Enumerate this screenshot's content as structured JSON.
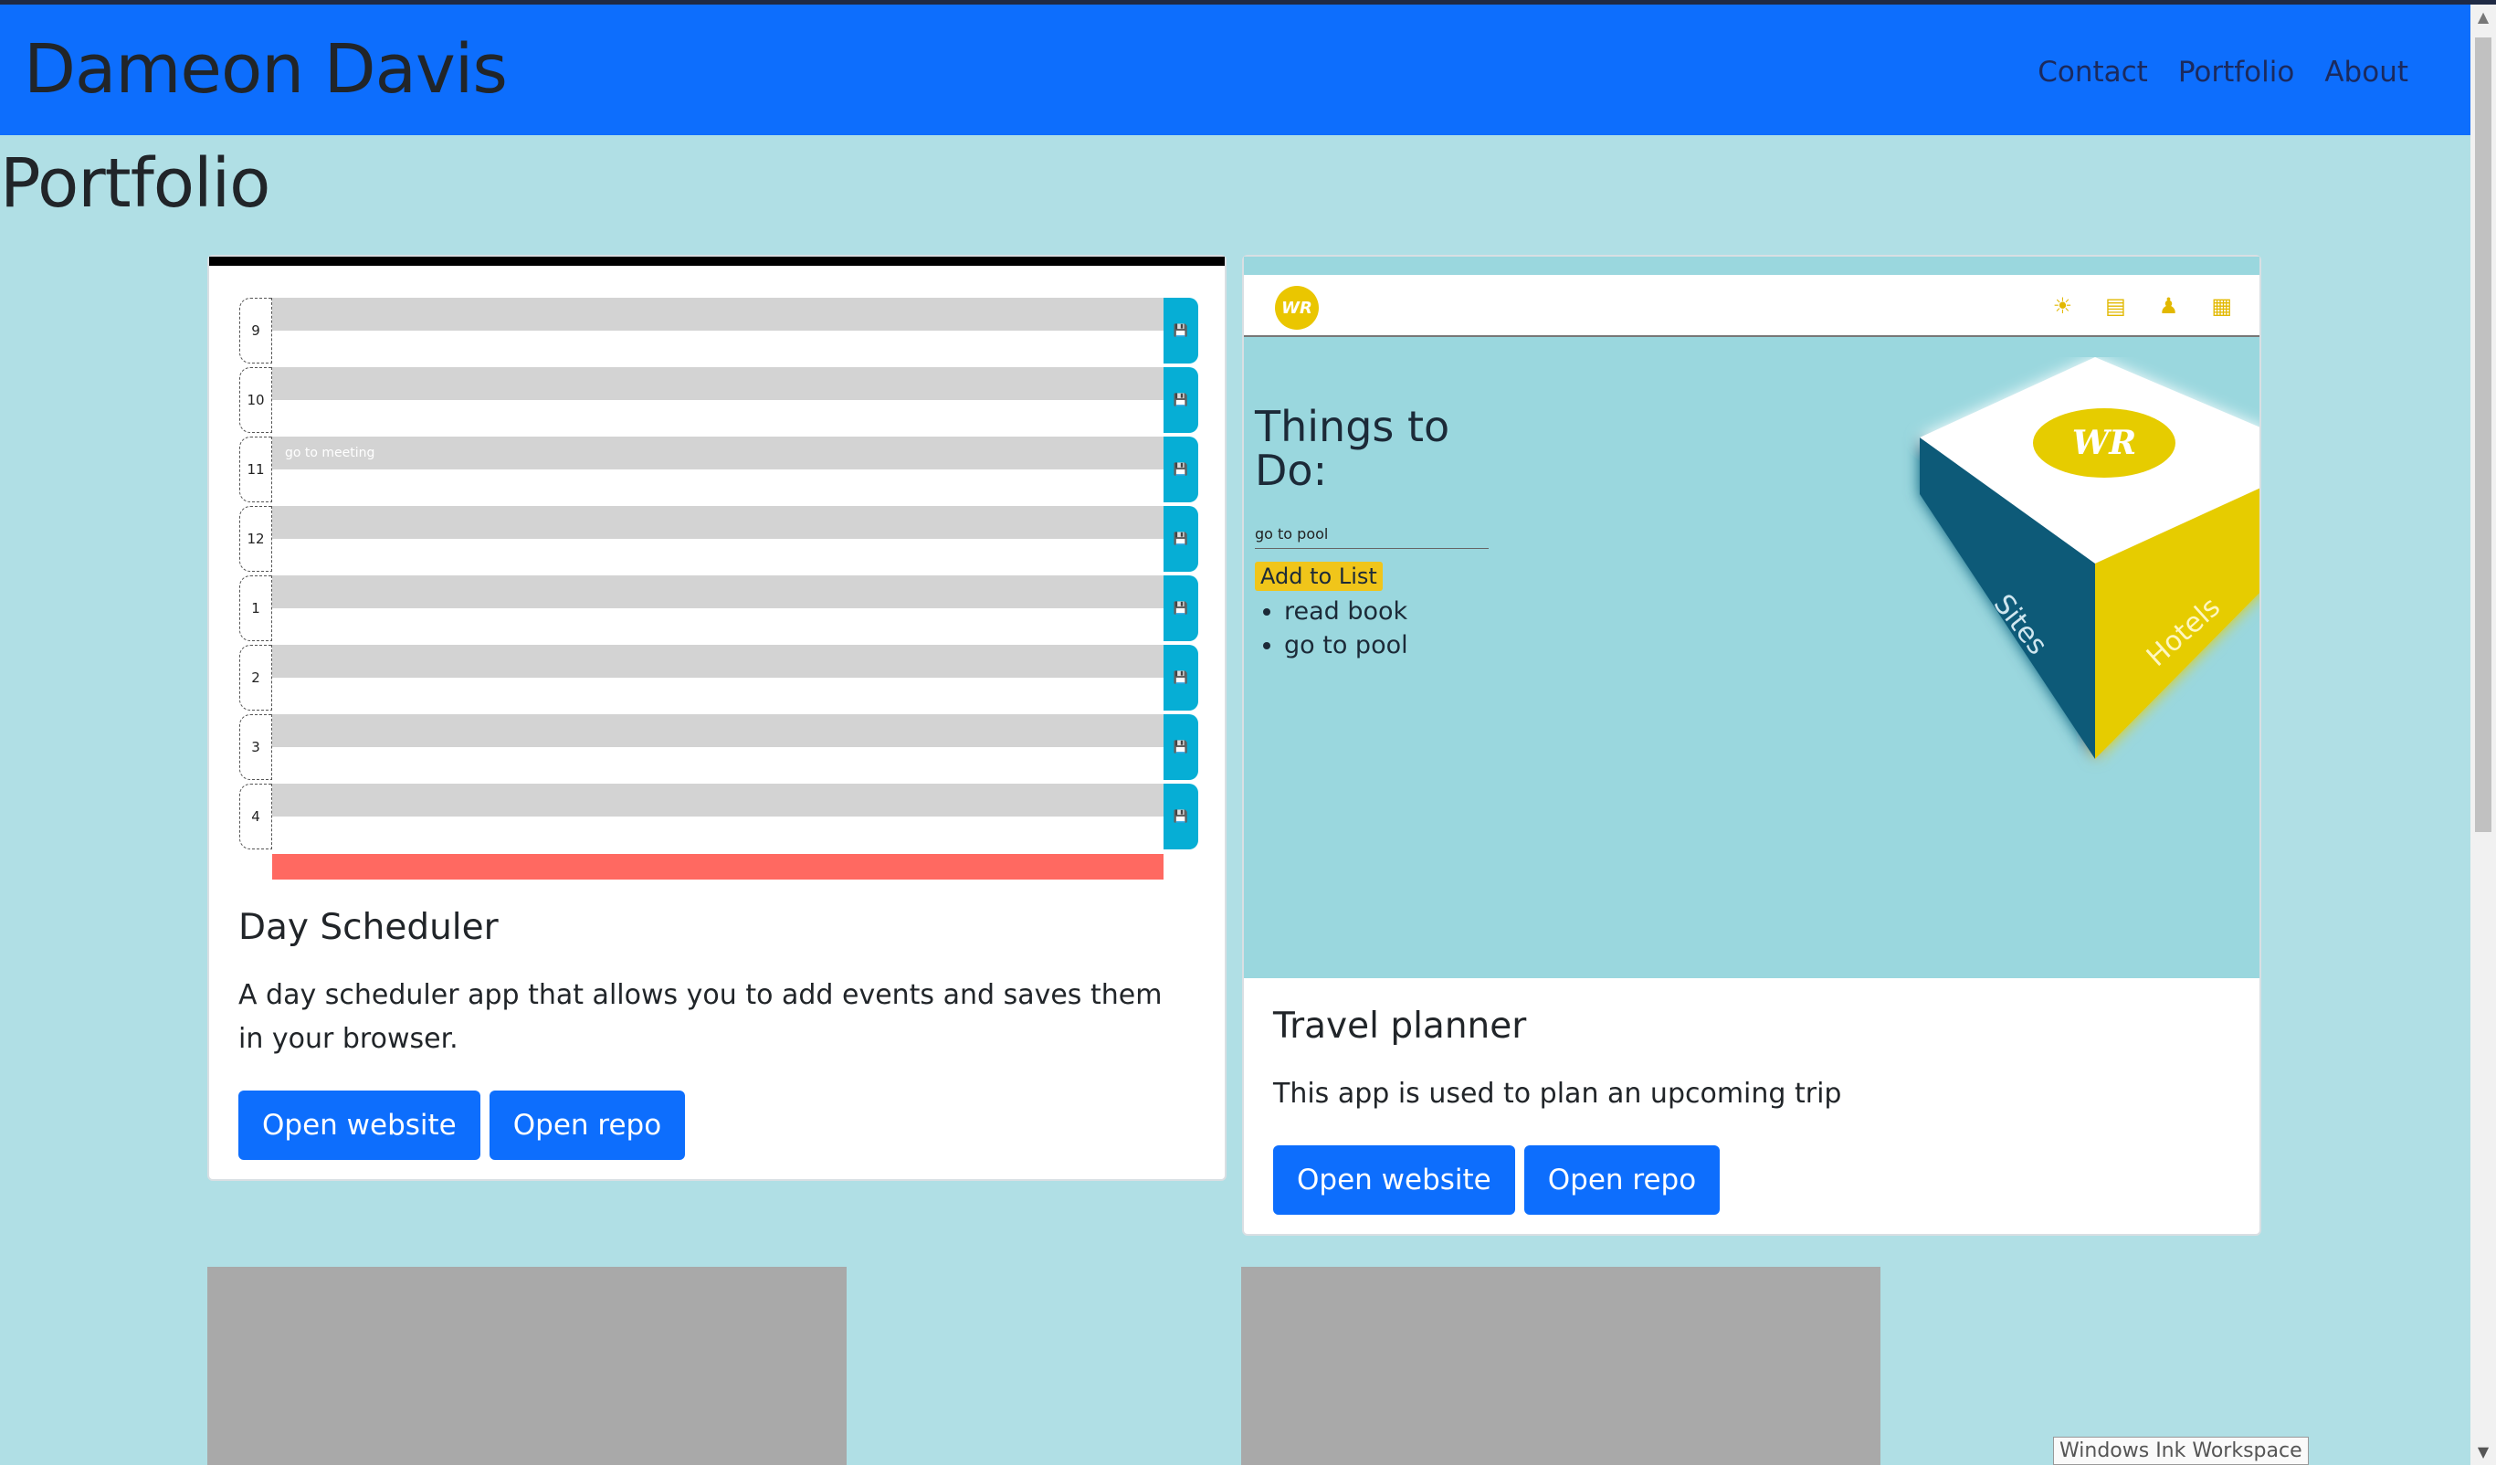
{
  "header": {
    "brand": "Dameon Davis",
    "nav": [
      "Contact",
      "Portfolio",
      "About"
    ]
  },
  "page_title": "Portfolio",
  "cards": [
    {
      "title": "Day Scheduler",
      "text": "A day scheduler app that allows you to add events and saves them in your browser.",
      "buttons": [
        "Open website",
        "Open repo"
      ],
      "preview": {
        "hours": [
          "9",
          "10",
          "11",
          "12",
          "1",
          "2",
          "3",
          "4"
        ],
        "entry_11": "go to meeting"
      }
    },
    {
      "title": "Travel planner",
      "text": "This app is used to plan an upcoming trip",
      "buttons": [
        "Open website",
        "Open repo"
      ],
      "preview": {
        "logo": "WR",
        "heading": "Things to Do:",
        "input_value": "go to pool",
        "add_button": "Add to List",
        "list": [
          "read book",
          "go to pool"
        ],
        "cube_logo": "WR",
        "cube_left": "Sites",
        "cube_right": "Hotels"
      }
    }
  ],
  "tooltip": "Windows Ink Workspace",
  "colors": {
    "navbar": "#0d6efd",
    "background": "#b0dfe5",
    "button": "#0d6efd",
    "placeholder": "#a9a9a9"
  }
}
